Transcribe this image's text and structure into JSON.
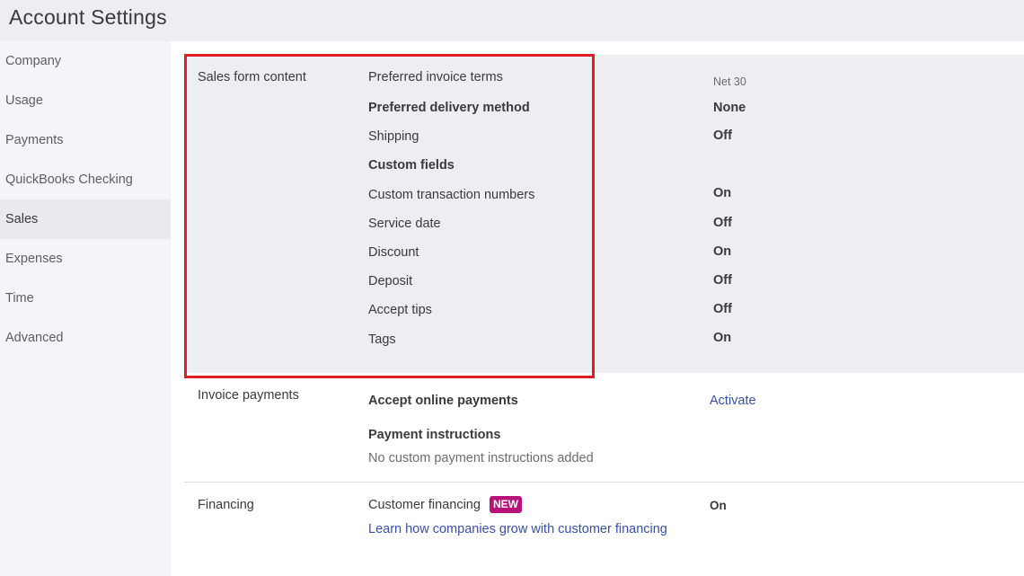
{
  "header": {
    "title": "Account Settings"
  },
  "sidebar": {
    "items": [
      {
        "label": "Company"
      },
      {
        "label": "Usage"
      },
      {
        "label": "Payments"
      },
      {
        "label": "QuickBooks Checking"
      },
      {
        "label": "Sales"
      },
      {
        "label": "Expenses"
      },
      {
        "label": "Time"
      },
      {
        "label": "Advanced"
      }
    ]
  },
  "sales_form": {
    "title": "Sales form content",
    "rows": [
      {
        "label": "Preferred invoice terms",
        "value": "Net 30"
      },
      {
        "label": "Preferred delivery method",
        "value": "None"
      },
      {
        "label": "Shipping",
        "value": "Off"
      },
      {
        "label": "Custom fields",
        "value": ""
      },
      {
        "label": "Custom transaction numbers",
        "value": "On"
      },
      {
        "label": "Service date",
        "value": "Off"
      },
      {
        "label": "Discount",
        "value": "On"
      },
      {
        "label": "Deposit",
        "value": "Off"
      },
      {
        "label": "Accept tips",
        "value": "Off"
      },
      {
        "label": "Tags",
        "value": "On"
      }
    ]
  },
  "invoice_payments": {
    "title": "Invoice payments",
    "accept_online_label": "Accept online payments",
    "activate_link": "Activate",
    "instructions_label": "Payment instructions",
    "instructions_value": "No custom payment instructions added"
  },
  "financing": {
    "title": "Financing",
    "customer_financing_label": "Customer financing",
    "badge": "NEW",
    "value": "On",
    "learn_link": "Learn how companies grow with customer financing"
  },
  "colors": {
    "highlight": "#e11d24",
    "link": "#3650a8",
    "badge": "#b8137a"
  }
}
